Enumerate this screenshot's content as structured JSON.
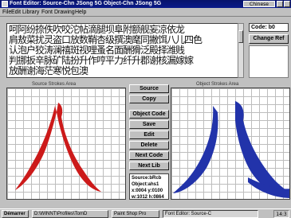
{
  "window": {
    "title": "Font Editor: Source-Chn JSong 5G    Object-Chn JSong 5G",
    "extra_label": "Chinese"
  },
  "menu": [
    "File",
    "Edit",
    "Library",
    "Font",
    "Drawing",
    "Help"
  ],
  "glyph_rows": [
    "呵阿纷捺佚吹咬沱帖滴腿坝阜附额舰妄凉依龙",
    "肩敖菜扰灵盗口放数鞘杏级撰澳麾同撇饵八儿四色",
    "认泡户狡涛澜禧斑视哩蚤名面酬猾泛殿择潍贱",
    "判挪扳辛脉矿陆扮升作哼平力纤升郡谢核漏嫁嫁",
    "放酬谢海茫寒悦包澳"
  ],
  "side": {
    "code_label": "Code: b0",
    "change_ref": "Change Ref"
  },
  "panels": {
    "source_label": "Source Strokes Area",
    "object_label": "Object Strokes Area"
  },
  "buttons": {
    "source": "Source",
    "copy": "Copy",
    "object_code": "Object Code",
    "save": "Save",
    "edit": "Edit",
    "delete": "Delete",
    "next_code": "Next Code",
    "next_lib": "Next Lib"
  },
  "info": {
    "line1": "Source:bRcb",
    "line2": "Object:ahs1",
    "line3": "x:0004 y:0100",
    "line4": "w:1012 h:0864"
  },
  "taskbar": {
    "start": "Démarrer",
    "task1": "D:\\WINNT\\Profiles\\TomD",
    "task2": "Paint Shop Pro",
    "task3": "Font Editor: Source-C",
    "clock": "14:3"
  },
  "colors": {
    "source_glyph": "#cc1a1a",
    "object_glyph": "#2233aa"
  }
}
